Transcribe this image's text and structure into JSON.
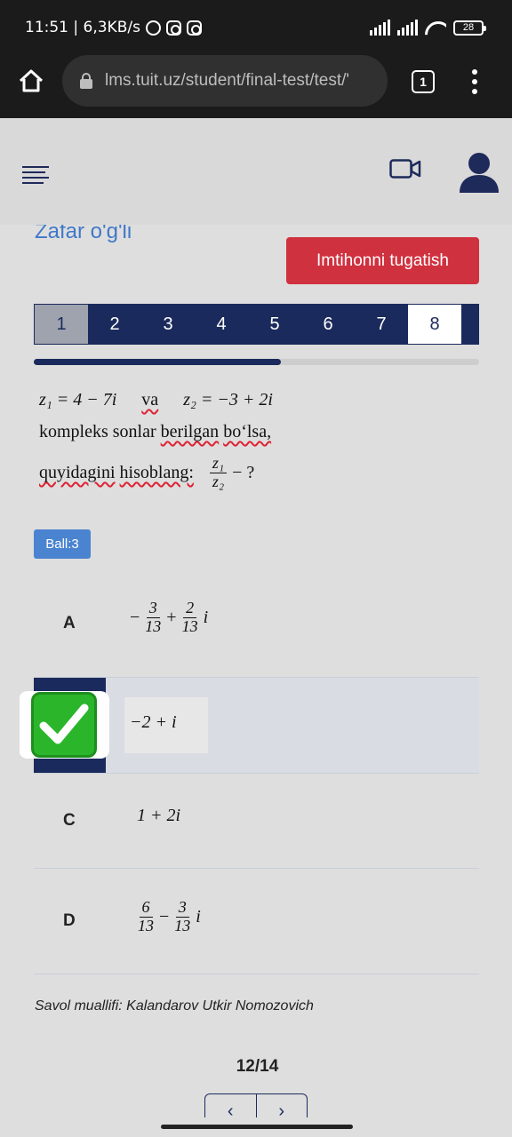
{
  "status": {
    "time_speed": "11:51 | 6,3KB/s",
    "battery": "28"
  },
  "browser": {
    "url": "lms.tuit.uz/student/final-test/test/'",
    "tab_count": "1"
  },
  "page": {
    "student_name": "Zafar o'g'li",
    "finish_button": "Imtihonni tugatish",
    "question_nav": [
      "1",
      "2",
      "3",
      "4",
      "5",
      "6",
      "7",
      "8"
    ],
    "progress_fraction": 0.555,
    "question": {
      "z1": "z₁ = 4 − 7i",
      "va": "va",
      "z2": "z₂ = −3 + 2i",
      "line2_a": "kompleks sonlar",
      "line2_b": "berilgan",
      "line2_c": "bo‘lsa,",
      "line3_a": "quyidagini",
      "line3_b": "hisoblang:",
      "frac_num": "z₁",
      "frac_den": "z₂",
      "frac_suffix": "− ?"
    },
    "ball": "Ball:3",
    "options": {
      "a": {
        "letter": "A",
        "sign": "−",
        "n1": "3",
        "d1": "13",
        "op": "+",
        "n2": "2",
        "d2": "13",
        "tail": "i"
      },
      "b": {
        "expr": "−2 + i"
      },
      "c": {
        "letter": "C",
        "expr": "1 + 2i"
      },
      "d": {
        "letter": "D",
        "n1": "6",
        "d1": "13",
        "op": "−",
        "n2": "3",
        "d2": "13",
        "tail": "i"
      }
    },
    "author": "Savol muallifi: Kalandarov Utkir Nomozovich",
    "counter": "12/14",
    "pager": {
      "prev": "‹",
      "next": "›"
    }
  }
}
